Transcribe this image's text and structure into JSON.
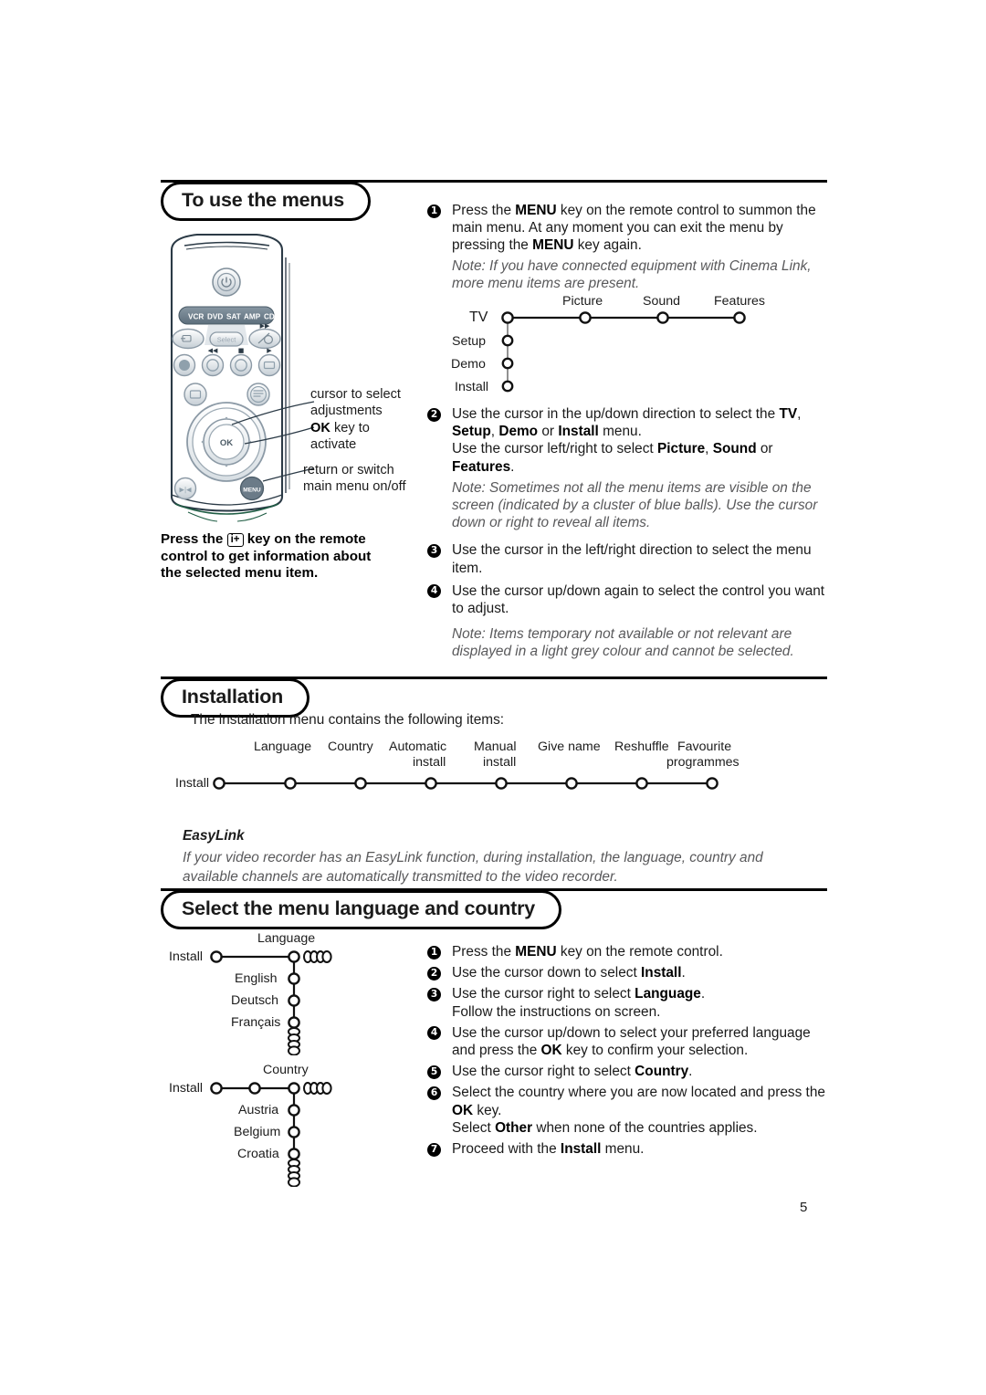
{
  "page": {
    "number": "5"
  },
  "section1": {
    "title": "To use the menus",
    "steps": [
      {
        "num": "1",
        "html": "Press the <b>MENU</b> key on the remote control to summon the main menu. At any moment you can exit the menu by pressing the <b>MENU</b> key again."
      },
      {
        "num": "1n",
        "html": "<span class=\"note\">Note: If you have connected equipment with Cinema Link, more menu items are present.</span>"
      },
      {
        "num": "2",
        "html": "Use the cursor in the up/down direction to select the <b>TV</b>, <b>Setup</b>, <b>Demo</b> or <b>Install</b> menu.<br>Use the cursor left/right to select <b>Picture</b>, <b>Sound</b> or <b>Features</b>."
      },
      {
        "num": "2n",
        "html": "<span class=\"note\">Note: Sometimes not all the menu items are visible on the screen (indicated by a cluster of blue balls). Use the cursor down or right to reveal all items.</span>"
      },
      {
        "num": "3",
        "html": "Use the cursor in the left/right direction to select the menu item."
      },
      {
        "num": "4",
        "html": "Use the cursor up/down again to select the control you want to adjust."
      },
      {
        "num": "4n",
        "html": "<span class=\"note\">Note: Items temporary not available or not relevant are displayed in a light grey colour and cannot be selected.</span>"
      }
    ],
    "step1_line1": "Press the ",
    "menu_diagram": {
      "root": "TV",
      "row_items": [
        "Picture",
        "Sound",
        "Features"
      ],
      "column_items": [
        "Setup",
        "Demo",
        "Install"
      ]
    },
    "callouts": [
      "cursor to select",
      "adjustments",
      "OK key to",
      "activate",
      "return or switch",
      "main menu on/off"
    ],
    "callout_ok_bold": "OK",
    "info_block": {
      "pre": "Press the ",
      "key": "i+",
      "post": " key on the remote control to get information about the selected menu item."
    },
    "remote": {
      "device_keys": [
        "VCR",
        "DVD",
        "SAT",
        "AMP",
        "CD"
      ],
      "select_label": "Select",
      "ok_label": "OK",
      "menu_label": "MENU"
    }
  },
  "section2": {
    "title": "Installation",
    "intro": "The installation menu contains the following items:",
    "diagram": {
      "root": "Install",
      "items": [
        {
          "line1": "Language",
          "line2": ""
        },
        {
          "line1": "Country",
          "line2": ""
        },
        {
          "line1": "Automatic",
          "line2": "install"
        },
        {
          "line1": "Manual",
          "line2": "install"
        },
        {
          "line1": "Give name",
          "line2": ""
        },
        {
          "line1": "Reshuffle",
          "line2": ""
        },
        {
          "line1": "Favourite",
          "line2": "programmes"
        }
      ]
    },
    "easylink_title": "EasyLink",
    "easylink_text": "If your video recorder has an EasyLink function, during installation, the language, country and available channels are automatically transmitted to the video recorder."
  },
  "section3": {
    "title": "Select the menu language and country",
    "language_diagram": {
      "root": "Install",
      "node": "Language",
      "children": [
        "English",
        "Deutsch",
        "Français"
      ]
    },
    "country_diagram": {
      "root": "Install",
      "node": "Country",
      "children": [
        "Austria",
        "Belgium",
        "Croatia"
      ]
    },
    "steps": [
      {
        "num": "1",
        "html": "Press the <b>MENU</b> key on the remote control."
      },
      {
        "num": "2",
        "html": "Use the cursor down to select <b>Install</b>."
      },
      {
        "num": "3",
        "html": "Use the cursor right to select <b>Language</b>.<br>Follow the instructions on screen."
      },
      {
        "num": "4",
        "html": "Use the cursor up/down to select your preferred language and press the <b>OK</b> key to confirm your selection."
      },
      {
        "num": "5",
        "html": "Use the cursor right to select <b>Country</b>."
      },
      {
        "num": "6",
        "html": "Select the country where you are now located and press the <b>OK</b> key.<br>Select <b>Other</b> when none of the countries applies."
      },
      {
        "num": "7",
        "html": "Proceed with the <b>Install</b> menu."
      }
    ]
  },
  "colors": {
    "ink": "#1c1c1c",
    "note": "#59595b",
    "remote_body": "#ffffff",
    "remote_outline": "#2b3a46",
    "remote_key": "#8a9aa6",
    "remote_bar": "#5d6f7c"
  }
}
